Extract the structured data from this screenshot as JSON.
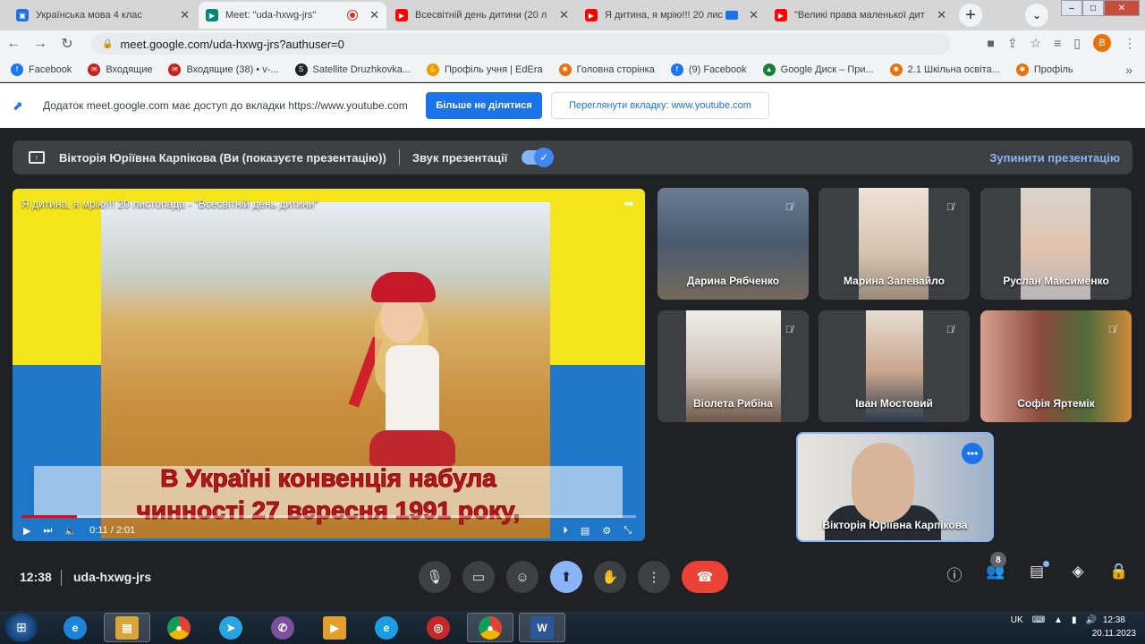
{
  "browser": {
    "tabs": [
      {
        "title": "Українська мова 4 клас",
        "color": "#1a73e8"
      },
      {
        "title": "Meet: \"uda-hxwg-jrs\"",
        "color": "#00897b"
      },
      {
        "title": "Всесвітній день дитини (20 л",
        "color": "#ff0000"
      },
      {
        "title": "Я дитина, я мрію!!! 20 лис",
        "color": "#ff0000"
      },
      {
        "title": "\"Великі права маленької дит",
        "color": "#ff0000"
      }
    ],
    "url": "meet.google.com/uda-hxwg-jrs?authuser=0",
    "profile_initial": "B"
  },
  "bookmarks": [
    {
      "label": "Facebook",
      "color": "#1877f2"
    },
    {
      "label": "Входящие",
      "color": "#c5221f"
    },
    {
      "label": "Входящие (38) • v-...",
      "color": "#c5221f"
    },
    {
      "label": "Satellite Druzhkovka...",
      "color": "#202124"
    },
    {
      "label": "Профіль учня | EdEra",
      "color": "#f29900"
    },
    {
      "label": "Головна сторінка",
      "color": "#e8710a"
    },
    {
      "label": "(9) Facebook",
      "color": "#1877f2"
    },
    {
      "label": "Google Диск – При...",
      "color": "#188038"
    },
    {
      "label": "2.1 Шкільна освіта...",
      "color": "#e8710a"
    },
    {
      "label": "Профіль",
      "color": "#e8710a"
    }
  ],
  "sharebar": {
    "message": "Додаток meet.google.com має доступ до вкладки https://www.youtube.com",
    "stop_label": "Більше не ділитися",
    "view_label": "Переглянути вкладку: www.youtube.com"
  },
  "presenting": {
    "presenter": "Вікторія Юріївна Карпікова (Ви (показуєте презентацію))",
    "sound_label": "Звук презентації",
    "stop_label": "Зупинити презентацію"
  },
  "video": {
    "title": "Я дитина, я мрію!!! 20 листопада - \"Всесвітній день дитини\"",
    "caption_line1": "В Україні конвенція набула",
    "caption_line2": "чинності 27 вересня 1991 року,",
    "time": "0:11 / 2:01",
    "progress": 0.09
  },
  "participants": [
    {
      "name": "Дарина Рябченко"
    },
    {
      "name": "Марина Запевайло"
    },
    {
      "name": "Руслан Максименко"
    },
    {
      "name": "Віолета Рибіна"
    },
    {
      "name": "Іван Мостовий"
    },
    {
      "name": "Софія Яртемік"
    }
  ],
  "self_tile": {
    "name": "Вікторія Юріївна Карпікова"
  },
  "meet": {
    "time": "12:38",
    "code": "uda-hxwg-jrs",
    "people_count": "8"
  },
  "taskbar": {
    "lang": "UK",
    "time": "12:38",
    "date": "20.11.2023"
  }
}
